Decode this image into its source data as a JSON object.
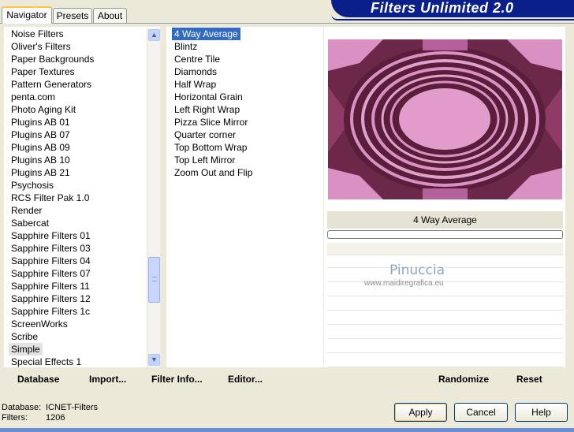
{
  "header": {
    "title": "Filters Unlimited 2.0"
  },
  "tabs": [
    {
      "label": "Navigator",
      "active": true
    },
    {
      "label": "Presets",
      "active": false
    },
    {
      "label": "About",
      "active": false
    }
  ],
  "categories": [
    "Noise Filters",
    "Oliver's Filters",
    "Paper Backgrounds",
    "Paper Textures",
    "Pattern Generators",
    "penta.com",
    "Photo Aging Kit",
    "Plugins AB 01",
    "Plugins AB 07",
    "Plugins AB 09",
    "Plugins AB 10",
    "Plugins AB 21",
    "Psychosis",
    "RCS Filter Pak 1.0",
    "Render",
    "Sabercat",
    "Sapphire Filters 01",
    "Sapphire Filters 03",
    "Sapphire Filters 04",
    "Sapphire Filters 07",
    "Sapphire Filters 11",
    "Sapphire Filters 12",
    "Sapphire Filters 1c",
    "ScreenWorks",
    "Scribe",
    "Simple",
    "Special Effects 1"
  ],
  "selected_category": "Simple",
  "filters": [
    "4 Way Average",
    "Blintz",
    "Centre Tile",
    "Diamonds",
    "Half Wrap",
    "Horizontal Grain",
    "Left Right Wrap",
    "Pizza Slice Mirror",
    "Quarter corner",
    "Top Bottom Wrap",
    "Top Left Mirror",
    "Zoom Out and Flip"
  ],
  "selected_filter": "4 Way Average",
  "preview": {
    "filter_name": "4 Way Average"
  },
  "watermark": {
    "name": "Pinuccia",
    "url": "www.maidiregrafica.eu"
  },
  "toolbar": {
    "database": "Database",
    "import": "Import...",
    "filter_info": "Filter Info...",
    "editor": "Editor...",
    "randomize": "Randomize",
    "reset": "Reset"
  },
  "status": {
    "database_label": "Database:",
    "database_value": "ICNET-Filters",
    "filters_label": "Filters:",
    "filters_value": "1206"
  },
  "buttons": {
    "apply": "Apply",
    "cancel": "Cancel",
    "help": "Help"
  },
  "colors": {
    "selection": "#316ac5",
    "header": "#0a1f8a",
    "preview_dark": "#6c2848",
    "preview_light": "#d991c3"
  },
  "icons": {
    "scroll_up": "scroll-up-arrow",
    "scroll_down": "scroll-down-arrow"
  }
}
